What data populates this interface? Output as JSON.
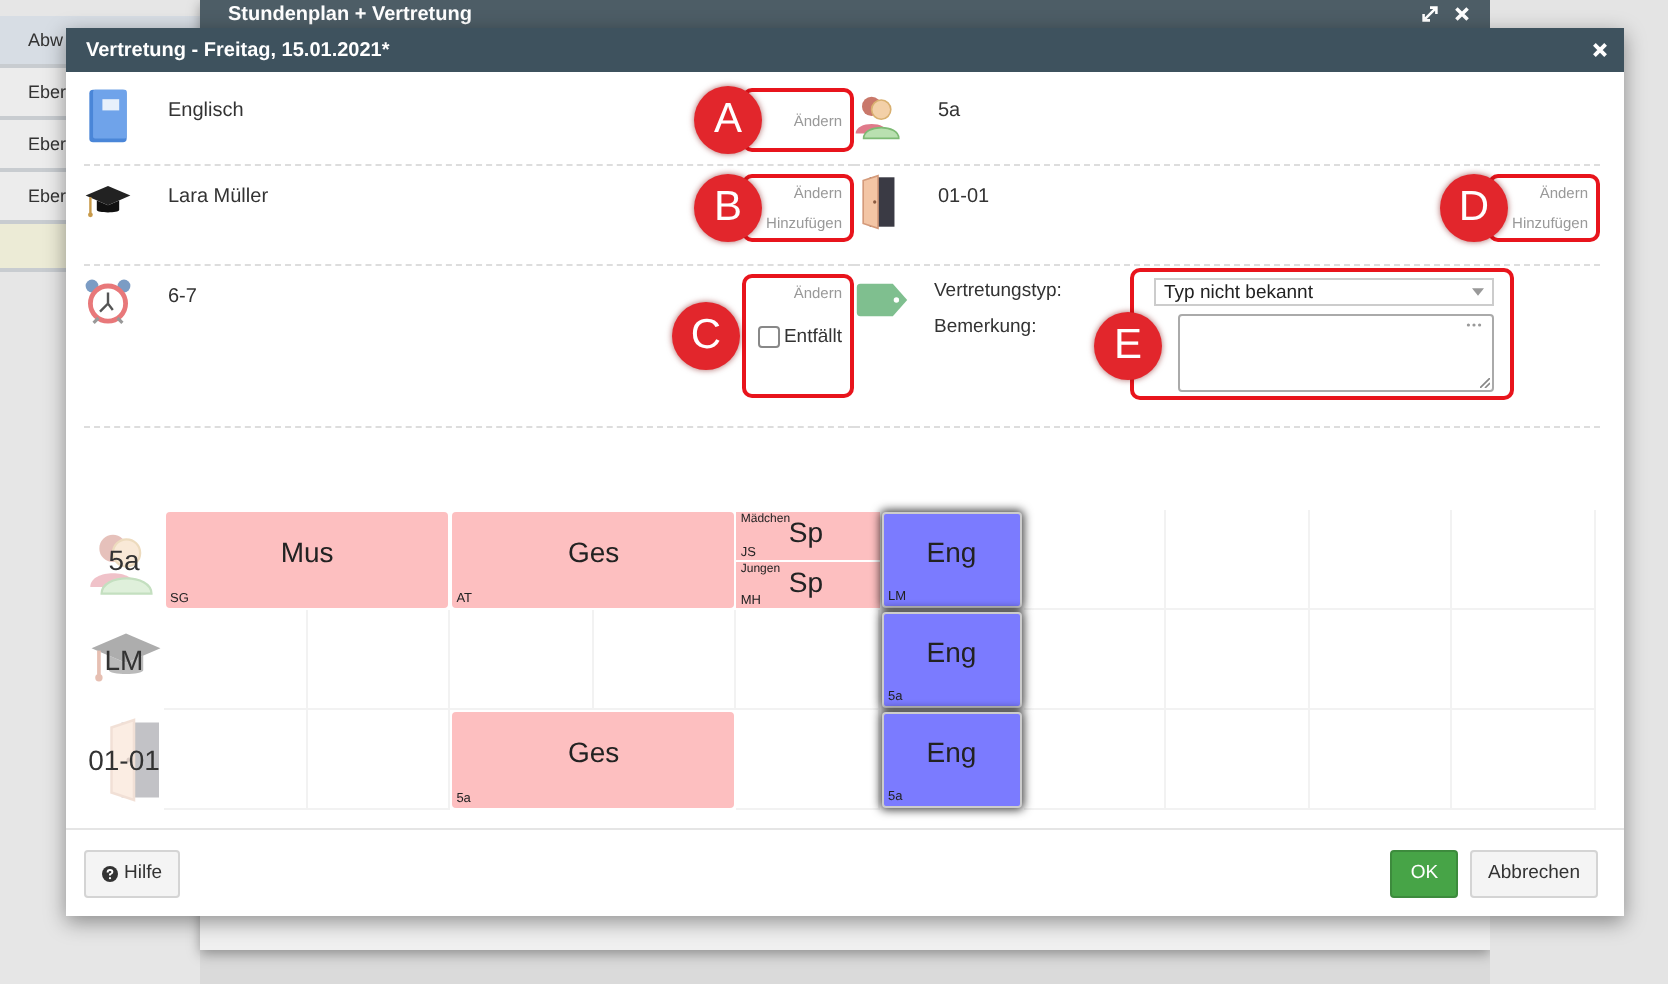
{
  "background": {
    "list_items": [
      {
        "label": "Abw",
        "selected": true
      },
      {
        "label": "Eber",
        "selected": false
      },
      {
        "label": "Eber",
        "selected": false
      },
      {
        "label": "Eber",
        "selected": false
      }
    ],
    "window": {
      "title": "Stundenplan + Vertretung"
    }
  },
  "dialog": {
    "title": "Vertretung - Freitag, 15.01.2021*",
    "fields": [
      {
        "kind": "subject",
        "value": "Englisch",
        "actions": [
          "Ändern"
        ],
        "marker": "A"
      },
      {
        "kind": "class",
        "value": "5a"
      },
      {
        "kind": "teacher",
        "value": "Lara Müller",
        "actions": [
          "Ändern",
          "Hinzufügen"
        ],
        "marker": "B"
      },
      {
        "kind": "room",
        "value": "01-01",
        "actions": [
          "Ändern",
          "Hinzufügen"
        ],
        "marker": "D"
      },
      {
        "kind": "time",
        "value": "6-7",
        "actions": [
          "Ändern"
        ],
        "checkbox": {
          "label": "Entfällt",
          "checked": false
        },
        "marker": "C"
      },
      {
        "kind": "type",
        "type_label": "Vertretungstyp:",
        "type_value": "Typ nicht bekannt",
        "remark_label": "Bemerkung:",
        "marker": "E"
      }
    ],
    "timetable": [
      {
        "kind": "class",
        "label": "5a",
        "slots": [
          {
            "kind": "double_lesson",
            "subject": "Mus",
            "note": "SG",
            "highlighted": false
          },
          {
            "kind": "double_lesson",
            "subject": "Ges",
            "note": "AT",
            "highlighted": false
          },
          {
            "kind": "split",
            "parts": [
              {
                "group": "Mädchen",
                "teacher": "JS",
                "subject": "Sp"
              },
              {
                "group": "Jungen",
                "teacher": "MH",
                "subject": "Sp"
              }
            ]
          },
          {
            "kind": "single_lesson",
            "subject": "Eng",
            "note": "LM",
            "highlighted": true
          },
          {
            "kind": "empty"
          },
          {
            "kind": "empty"
          },
          {
            "kind": "empty"
          },
          {
            "kind": "empty"
          }
        ]
      },
      {
        "kind": "teacher",
        "label": "LM",
        "slots": [
          {
            "kind": "empty"
          },
          {
            "kind": "empty"
          },
          {
            "kind": "empty"
          },
          {
            "kind": "empty"
          },
          {
            "kind": "empty"
          },
          {
            "kind": "single_lesson",
            "subject": "Eng",
            "note": "5a",
            "highlighted": true
          },
          {
            "kind": "empty"
          },
          {
            "kind": "empty"
          },
          {
            "kind": "empty"
          },
          {
            "kind": "empty"
          }
        ]
      },
      {
        "kind": "room",
        "label": "01-01",
        "slots": [
          {
            "kind": "empty"
          },
          {
            "kind": "empty"
          },
          {
            "kind": "double_lesson",
            "subject": "Ges",
            "note": "5a",
            "highlighted": false
          },
          {
            "kind": "empty"
          },
          {
            "kind": "single_lesson",
            "subject": "Eng",
            "note": "5a",
            "highlighted": true
          },
          {
            "kind": "empty"
          },
          {
            "kind": "empty"
          },
          {
            "kind": "empty"
          },
          {
            "kind": "empty"
          }
        ]
      }
    ],
    "buttons": [
      {
        "kind": "help",
        "label": "Hilfe"
      },
      {
        "kind": "primary",
        "label": "OK"
      },
      {
        "kind": "default",
        "label": "Abbrechen"
      }
    ]
  }
}
